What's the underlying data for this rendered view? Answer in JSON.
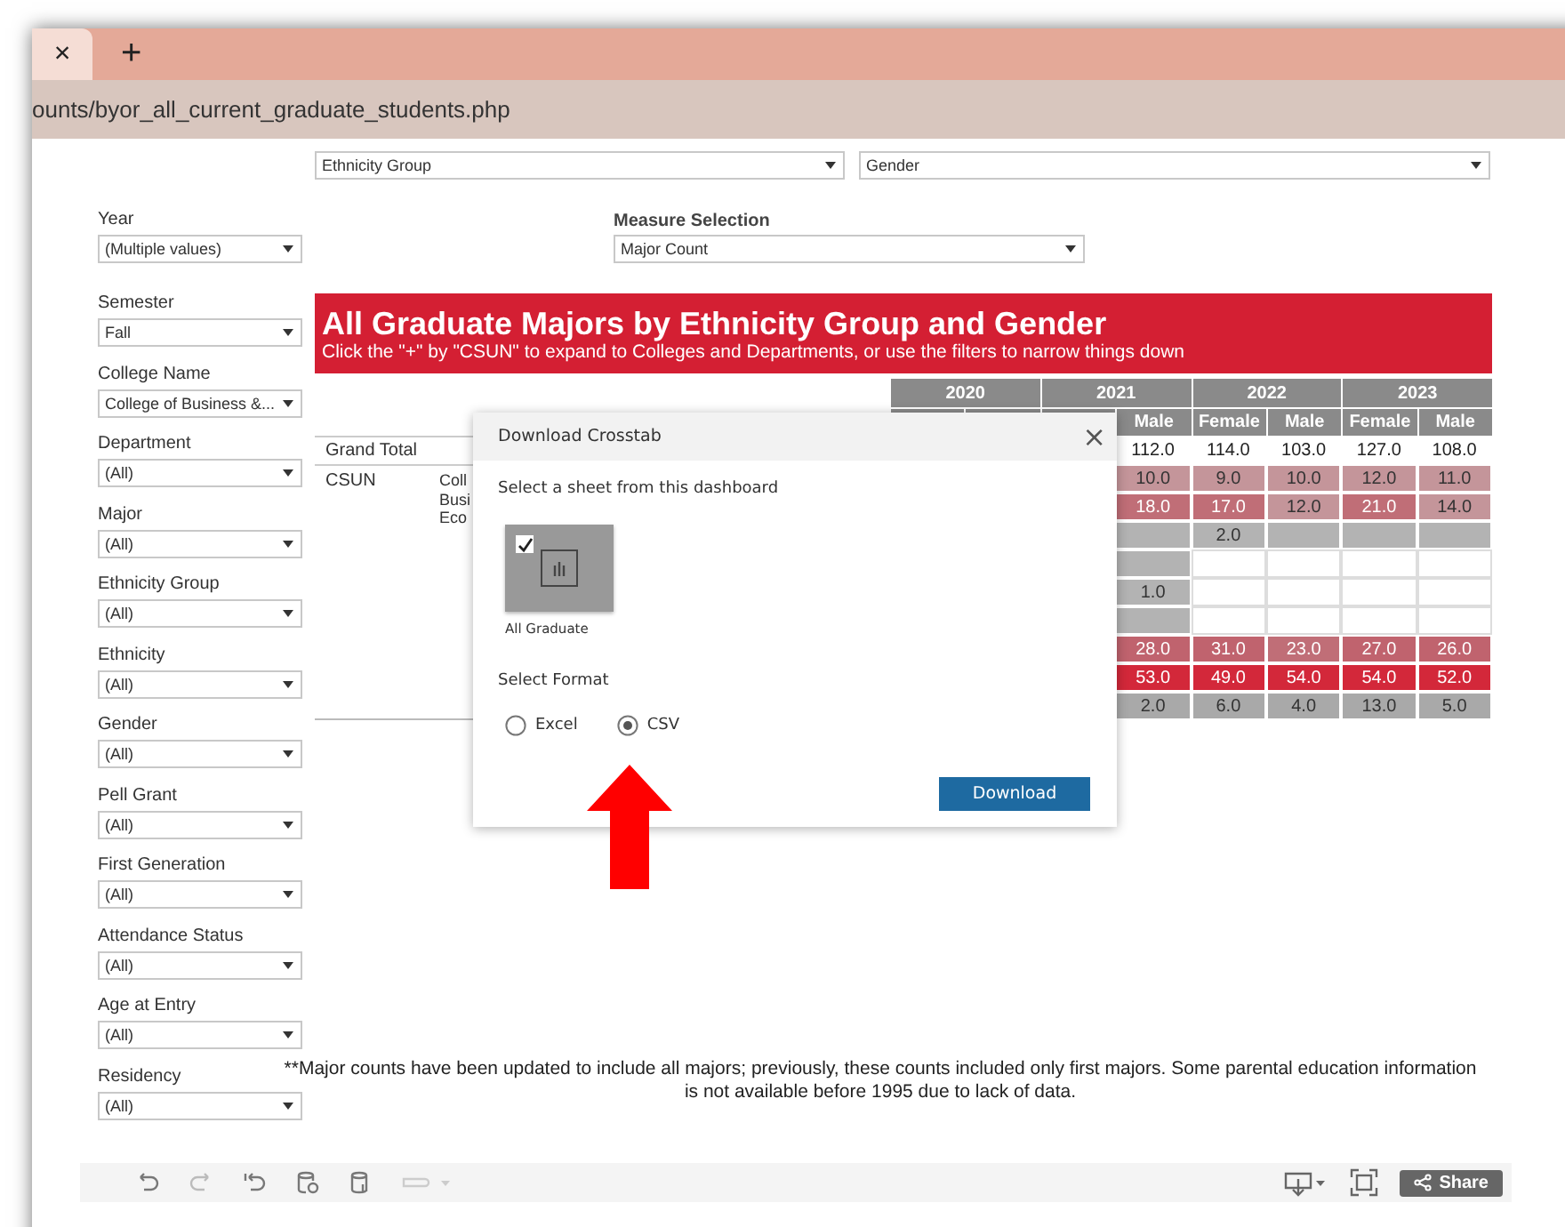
{
  "browser": {
    "tab_close": "×",
    "new_tab": "+",
    "address": "ounts/byor_all_current_graduate_students.php"
  },
  "top_filters": [
    {
      "value": "Ethnicity Group"
    },
    {
      "value": "Gender"
    }
  ],
  "measure": {
    "label": "Measure Selection",
    "value": "Major Count"
  },
  "filters": [
    {
      "label": "Year",
      "value": "(Multiple values)"
    },
    {
      "label": "Semester",
      "value": "Fall"
    },
    {
      "label": "College Name",
      "value": "College of Business &..."
    },
    {
      "label": "Department",
      "value": "(All)"
    },
    {
      "label": "Major",
      "value": "(All)"
    },
    {
      "label": "Ethnicity Group",
      "value": "(All)"
    },
    {
      "label": "Ethnicity",
      "value": "(All)"
    },
    {
      "label": "Gender",
      "value": "(All)"
    },
    {
      "label": "Pell Grant",
      "value": "(All)"
    },
    {
      "label": "First Generation",
      "value": "(All)"
    },
    {
      "label": "Attendance Status",
      "value": "(All)"
    },
    {
      "label": "Age at Entry",
      "value": "(All)"
    },
    {
      "label": "Residency",
      "value": "(All)"
    }
  ],
  "banner": {
    "title": "All Graduate Majors by Ethnicity Group and Gender",
    "subtitle": "Click the \"+\" by \"CSUN\" to expand to Colleges and Departments, or use the filters to narrow things down"
  },
  "table": {
    "years": [
      "2020",
      "2021",
      "2022",
      "2023"
    ],
    "genders": [
      "Male",
      "Female",
      "Male",
      "Female",
      "Male"
    ],
    "grand_total": "Grand Total",
    "group": "CSUN",
    "subgroup": [
      "Coll",
      "Busi",
      "Eco"
    ],
    "rows": [
      {
        "cells": [
          {
            "value": "112.0",
            "color": "#ffffff"
          },
          {
            "value": "114.0",
            "color": "#ffffff"
          },
          {
            "value": "103.0",
            "color": "#ffffff"
          },
          {
            "value": "127.0",
            "color": "#ffffff"
          },
          {
            "value": "108.0",
            "color": "#ffffff"
          }
        ]
      },
      {
        "cells": [
          {
            "value": "10.0",
            "color": "#c4959a"
          },
          {
            "value": "9.0",
            "color": "#c4959a"
          },
          {
            "value": "10.0",
            "color": "#c4959a"
          },
          {
            "value": "12.0",
            "color": "#c4959a"
          },
          {
            "value": "11.0",
            "color": "#c4959a"
          }
        ]
      },
      {
        "cells": [
          {
            "value": "18.0",
            "color": "#c06e77"
          },
          {
            "value": "17.0",
            "color": "#c06e77"
          },
          {
            "value": "12.0",
            "color": "#c4959a"
          },
          {
            "value": "21.0",
            "color": "#c06e77"
          },
          {
            "value": "14.0",
            "color": "#c4959a"
          }
        ]
      },
      {
        "cells": [
          {
            "color": "#b3b3b3"
          },
          {
            "value": "2.0",
            "color": "#b3b3b3"
          },
          {
            "color": "#b3b3b3"
          },
          {
            "color": "#b3b3b3"
          },
          {
            "color": "#b3b3b3"
          }
        ]
      },
      {
        "cells": [
          {
            "color": "#b3b3b3"
          },
          {
            "color": "#ffffff"
          },
          {
            "color": "#ffffff"
          },
          {
            "color": "#ffffff"
          },
          {
            "color": "#ffffff"
          }
        ]
      },
      {
        "cells": [
          {
            "value": "1.0",
            "color": "#b3b3b3"
          },
          {
            "color": "#ffffff"
          },
          {
            "color": "#ffffff"
          },
          {
            "color": "#ffffff"
          },
          {
            "color": "#ffffff"
          }
        ]
      },
      {
        "cells": [
          {
            "color": "#b3b3b3"
          },
          {
            "color": "#ffffff"
          },
          {
            "color": "#ffffff"
          },
          {
            "color": "#ffffff"
          },
          {
            "color": "#ffffff"
          }
        ]
      },
      {
        "cells": [
          {
            "value": "28.0",
            "color": "#c0636e"
          },
          {
            "value": "31.0",
            "color": "#c0636e"
          },
          {
            "value": "23.0",
            "color": "#c06e77"
          },
          {
            "value": "27.0",
            "color": "#c0636e"
          },
          {
            "value": "26.0",
            "color": "#c0636e"
          }
        ]
      },
      {
        "cells": [
          {
            "value": "53.0",
            "color": "#d3283a"
          },
          {
            "value": "49.0",
            "color": "#d3283a"
          },
          {
            "value": "54.0",
            "color": "#d3283a"
          },
          {
            "value": "54.0",
            "color": "#d3283a"
          },
          {
            "value": "52.0",
            "color": "#d3283a"
          }
        ]
      },
      {
        "cells": [
          {
            "value": "2.0",
            "color": "#a9a9a9"
          },
          {
            "value": "6.0",
            "color": "#a9a9a9"
          },
          {
            "value": "4.0",
            "color": "#a9a9a9"
          },
          {
            "value": "13.0",
            "color": "#a9a9a9"
          },
          {
            "value": "5.0",
            "color": "#a9a9a9"
          }
        ]
      }
    ]
  },
  "dialog": {
    "title": "Download Crosstab",
    "close": "×",
    "sheet_prompt": "Select a sheet from this dashboard",
    "sheets": [
      {
        "label": "All Graduate",
        "checked": true
      }
    ],
    "format_prompt": "Select Format",
    "formats": [
      {
        "label": "Excel",
        "selected": false
      },
      {
        "label": "CSV",
        "selected": true
      }
    ],
    "button": "Download"
  },
  "footnote": "**Major counts have been updated to include all majors; previously, these counts included only first majors.  Some parental education information is not available before 1995 due to lack of data.",
  "toolbar": {
    "share": "Share"
  }
}
